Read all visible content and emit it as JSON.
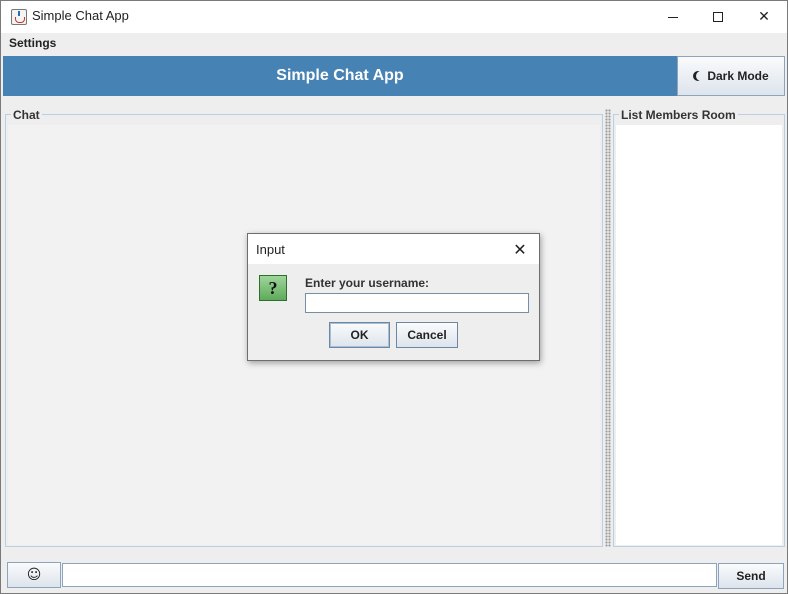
{
  "window": {
    "title": "Simple Chat App",
    "icon": "java-cup-icon"
  },
  "menubar": {
    "items": [
      {
        "label": "Settings"
      }
    ]
  },
  "header": {
    "title": "Simple Chat App",
    "background_color": "#4682b4",
    "dark_mode_button": {
      "label": "Dark Mode",
      "icon": "moon-icon"
    }
  },
  "chat_panel": {
    "title": "Chat"
  },
  "members_panel": {
    "title": "List Members Room"
  },
  "bottom_bar": {
    "emoji_button": {
      "icon": "smiley-icon",
      "glyph": "☺"
    },
    "message_input": {
      "value": "",
      "placeholder": ""
    },
    "send_button": {
      "label": "Send"
    }
  },
  "dialog": {
    "title": "Input",
    "icon": "question-icon",
    "icon_glyph": "?",
    "prompt": "Enter your username:",
    "input": {
      "value": ""
    },
    "ok_label": "OK",
    "cancel_label": "Cancel"
  }
}
